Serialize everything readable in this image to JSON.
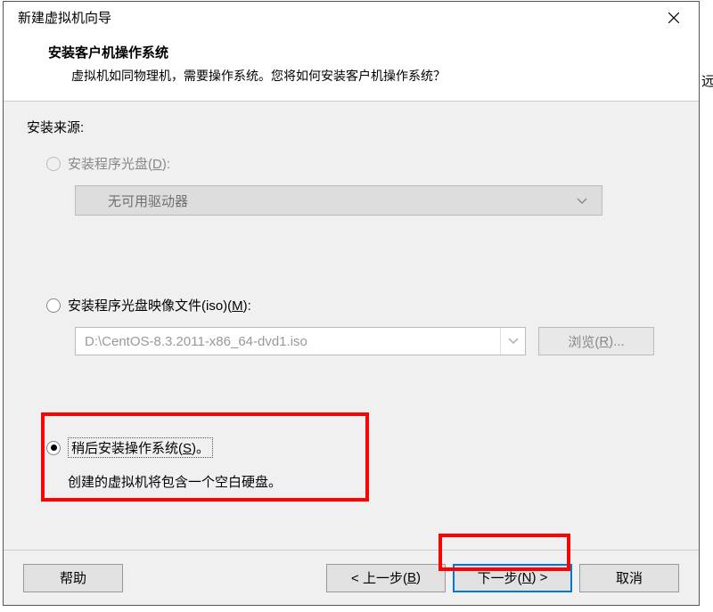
{
  "titlebar": {
    "title": "新建虚拟机向导"
  },
  "header": {
    "title": "安装客户机操作系统",
    "subtitle": "虚拟机如同物理机，需要操作系统。您将如何安装客户机操作系统？"
  },
  "section_label": "安装来源:",
  "option1": {
    "label_pre": "安装程序光盘(",
    "label_mn": "D",
    "label_post": "):",
    "dropdown_text": "无可用驱动器"
  },
  "option2": {
    "label_pre": "安装程序光盘映像文件(iso)(",
    "label_mn": "M",
    "label_post": "):",
    "iso_path": "D:\\CentOS-8.3.2011-x86_64-dvd1.iso",
    "browse_pre": "浏览(",
    "browse_mn": "R",
    "browse_post": ")..."
  },
  "option3": {
    "label_pre": "稍后安装操作系统(",
    "label_mn": "S",
    "label_post": ")。",
    "hint": "创建的虚拟机将包含一个空白硬盘。"
  },
  "footer": {
    "help": "帮助",
    "back_pre": "< 上一步(",
    "back_mn": "B",
    "back_post": ")",
    "next_pre": "下一步(",
    "next_mn": "N",
    "next_post": ") >",
    "cancel": "取消"
  },
  "behind_window": "远"
}
